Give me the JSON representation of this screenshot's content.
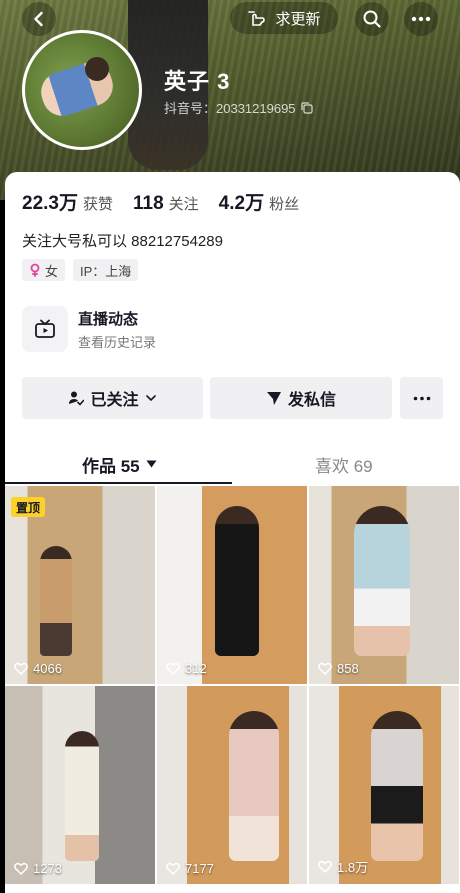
{
  "top_bar": {
    "back_icon": "chevron-left-icon",
    "update_request_label": "求更新",
    "update_icon": "pointing-hand-icon",
    "search_icon": "search-icon",
    "more_icon": "more-dots-icon"
  },
  "profile": {
    "username": "英子 3",
    "douyin_id": "抖音号：20331219695",
    "copy_icon": "copy-icon"
  },
  "stats": [
    {
      "value": "22.3万",
      "label": "获赞"
    },
    {
      "value": "118",
      "label": "关注"
    },
    {
      "value": "4.2万",
      "label": "粉丝"
    }
  ],
  "bio": "关注大号私可以 88212754289",
  "tags": {
    "gender": "女",
    "gender_icon": "female-icon",
    "ip": "IP：上海"
  },
  "live": {
    "title": "直播动态",
    "subtitle": "查看历史记录",
    "icon": "tv-icon"
  },
  "actions": {
    "following_label": "已关注",
    "message_label": "发私信",
    "more_icon": "more-dots-icon"
  },
  "tabs": {
    "works_label": "作品 55",
    "likes_label": "喜欢 69"
  },
  "videos": [
    {
      "likes": "4066",
      "pinned_label": "置顶"
    },
    {
      "likes": "312"
    },
    {
      "likes": "858"
    },
    {
      "likes": "1273"
    },
    {
      "likes": "7177"
    },
    {
      "likes": "1.8万"
    }
  ],
  "colors": {
    "text_primary": "#161823",
    "pin_badge": "#fcd12a",
    "female_accent": "#e1459f"
  }
}
